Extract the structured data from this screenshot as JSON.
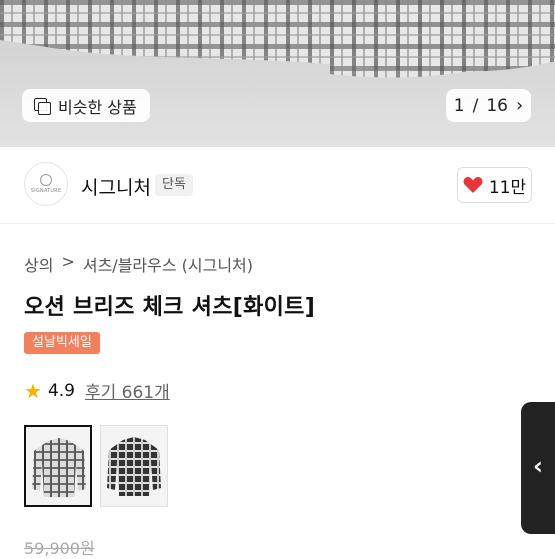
{
  "gallery": {
    "similar_label": "비슷한 상품",
    "current_page": "1",
    "total_pages": "16",
    "page_separator": "/",
    "icons": {
      "similar": "copy-icon",
      "next": "chevron-right-icon"
    }
  },
  "seller": {
    "logo_text": "SIGNATURE",
    "name": "시그니처",
    "badge": "단독",
    "likes": "11만",
    "like_icon": "heart-icon",
    "like_color": "#e8353b"
  },
  "breadcrumb": [
    "상의",
    "셔츠/블라우스 (시그니처)"
  ],
  "breadcrumb_separator": ">",
  "product": {
    "title": "오션 브리즈 체크 셔츠[화이트]",
    "sale_badge": "설날빅세일",
    "sale_badge_color": "#f0805e",
    "rating": "4.9",
    "reviews": "후기 661개",
    "original_price": "59,900원"
  },
  "variants": [
    {
      "name": "white-check",
      "selected": true
    },
    {
      "name": "black-check",
      "selected": false
    }
  ],
  "side_handle": {
    "icon": "chevron-left-icon",
    "glyph": "‹"
  }
}
